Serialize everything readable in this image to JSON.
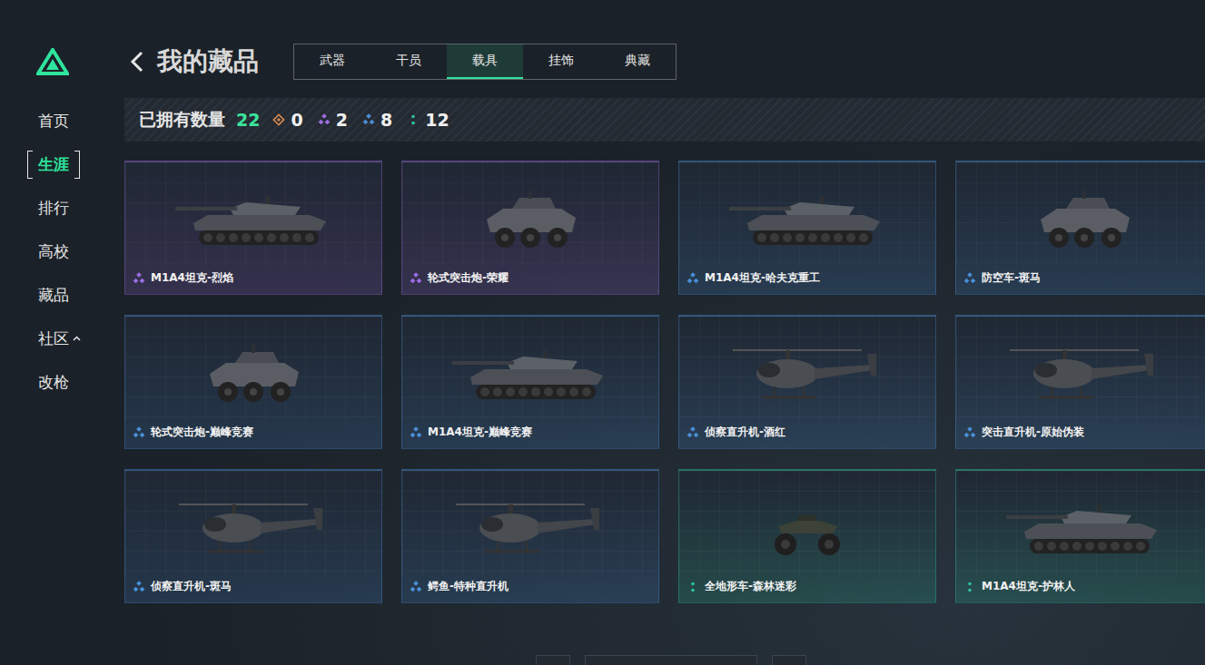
{
  "sidebar": {
    "items": [
      {
        "label": "首页",
        "selected": false,
        "expandable": false,
        "expanded": false
      },
      {
        "label": "生涯",
        "selected": true,
        "expandable": false,
        "expanded": false
      },
      {
        "label": "排行",
        "selected": false,
        "expandable": false,
        "expanded": false
      },
      {
        "label": "高校",
        "selected": false,
        "expandable": false,
        "expanded": false
      },
      {
        "label": "藏品",
        "selected": false,
        "expandable": false,
        "expanded": false
      },
      {
        "label": "社区",
        "selected": false,
        "expandable": true,
        "expanded": true
      },
      {
        "label": "改枪",
        "selected": false,
        "expandable": false,
        "expanded": false
      }
    ]
  },
  "header": {
    "title": "我的藏品",
    "tabs": [
      {
        "label": "武器",
        "selected": false
      },
      {
        "label": "干员",
        "selected": false
      },
      {
        "label": "载具",
        "selected": true
      },
      {
        "label": "挂饰",
        "selected": false
      },
      {
        "label": "典藏",
        "selected": false
      }
    ]
  },
  "summary": {
    "label": "已拥有数量",
    "total": "22",
    "tiers": [
      {
        "rarity": "legendary",
        "count": "0",
        "color": "#d98a4e"
      },
      {
        "rarity": "epic",
        "count": "2",
        "color": "#9c6fe4"
      },
      {
        "rarity": "rare",
        "count": "8",
        "color": "#4a8fd8"
      },
      {
        "rarity": "common",
        "count": "12",
        "color": "#2ec4a0"
      }
    ]
  },
  "vehicles": [
    {
      "name": "M1A4坦克-烈焰",
      "rarity": "epic",
      "color": "#9c6fe4",
      "kind": "tank"
    },
    {
      "name": "轮式突击炮-荣耀",
      "rarity": "epic",
      "color": "#9c6fe4",
      "kind": "wheeled"
    },
    {
      "name": "M1A4坦克-哈夫克重工",
      "rarity": "rare",
      "color": "#4a8fd8",
      "kind": "tank"
    },
    {
      "name": "防空车-斑马",
      "rarity": "rare",
      "color": "#4a8fd8",
      "kind": "wheeled"
    },
    {
      "name": "轮式突击炮-巅峰竞赛",
      "rarity": "rare",
      "color": "#4a8fd8",
      "kind": "wheeled"
    },
    {
      "name": "M1A4坦克-巅峰竞赛",
      "rarity": "rare",
      "color": "#4a8fd8",
      "kind": "tank"
    },
    {
      "name": "侦察直升机-酒红",
      "rarity": "rare",
      "color": "#4a8fd8",
      "kind": "heli"
    },
    {
      "name": "突击直升机-原始伪装",
      "rarity": "rare",
      "color": "#4a8fd8",
      "kind": "heli"
    },
    {
      "name": "侦察直升机-斑马",
      "rarity": "rare",
      "color": "#4a8fd8",
      "kind": "heli"
    },
    {
      "name": "鳄鱼-特种直升机",
      "rarity": "rare",
      "color": "#4a8fd8",
      "kind": "heli"
    },
    {
      "name": "全地形车-森林迷彩",
      "rarity": "common",
      "color": "#2ec4a0",
      "kind": "atv"
    },
    {
      "name": "M1A4坦克-护林人",
      "rarity": "common",
      "color": "#2ec4a0",
      "kind": "tank"
    }
  ]
}
